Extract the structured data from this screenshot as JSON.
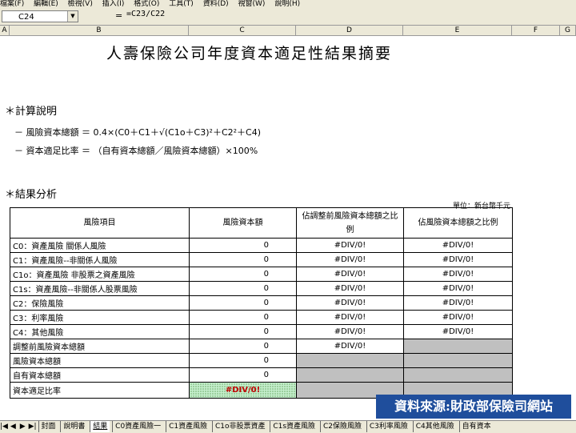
{
  "menu": [
    "檔案(F)",
    "編輯(E)",
    "檢視(V)",
    "插入(I)",
    "格式(O)",
    "工具(T)",
    "資料(D)",
    "視窗(W)",
    "說明(H)"
  ],
  "formula_bar": {
    "cell_ref": "C24",
    "equals": "=",
    "formula": "=C23/C22"
  },
  "columns": [
    "A",
    "B",
    "C",
    "D",
    "E",
    "F",
    "G"
  ],
  "sheet": {
    "title": "人壽保險公司年度資本適足性結果摘要",
    "section1": "＊計算說明",
    "line1": "－ 風險資本總額 ＝ 0.4×(C0＋C1＋√(C1o＋C3)²＋C2²＋C4)",
    "line2": "－ 資本適足比率 ＝ （自有資本總額／風險資本總額）×100%",
    "section2": "＊結果分析",
    "unit": "單位：新台幣千元",
    "headers": [
      "風險項目",
      "風險資本額",
      "佔調整前風險資本總額之比例",
      "佔風險資本總額之比例"
    ],
    "rows": [
      {
        "item": "C0：資產風險  關係人風險",
        "capital": "0",
        "pct_before": "#DIV/0!",
        "pct_total": "#DIV/0!"
      },
      {
        "item": "C1：資產風險--非關係人風險",
        "capital": "0",
        "pct_before": "#DIV/0!",
        "pct_total": "#DIV/0!"
      },
      {
        "item": "C1o：資產風險  非股票之資產風險",
        "capital": "0",
        "pct_before": "#DIV/0!",
        "pct_total": "#DIV/0!"
      },
      {
        "item": "C1s：資產風險--非關係人股票風險",
        "capital": "0",
        "pct_before": "#DIV/0!",
        "pct_total": "#DIV/0!"
      },
      {
        "item": "C2：保險風險",
        "capital": "0",
        "pct_before": "#DIV/0!",
        "pct_total": "#DIV/0!"
      },
      {
        "item": "C3：利率風險",
        "capital": "0",
        "pct_before": "#DIV/0!",
        "pct_total": "#DIV/0!"
      },
      {
        "item": "C4：其他風險",
        "capital": "0",
        "pct_before": "#DIV/0!",
        "pct_total": "#DIV/0!"
      },
      {
        "item": "調整前風險資本總額",
        "capital": "0",
        "pct_before": "#DIV/0!",
        "pct_total": ""
      }
    ],
    "total_row": {
      "item": "風險資本總額",
      "capital": "0"
    },
    "own_row": {
      "item": "自有資本總額",
      "capital": "0"
    },
    "ratio_row": {
      "item": "資本適足比率",
      "value": "#DIV/0!"
    }
  },
  "source_banner": "資料來源:財政部保險司網站",
  "tabs": [
    "封面",
    "說明書",
    "結果",
    "C0資產風險一",
    "C1資產風險",
    "C1o非股票資產",
    "C1s資產風險",
    "C2保險風險",
    "C3利率風險",
    "C4其他風險",
    "自有資本"
  ],
  "active_tab": 2
}
